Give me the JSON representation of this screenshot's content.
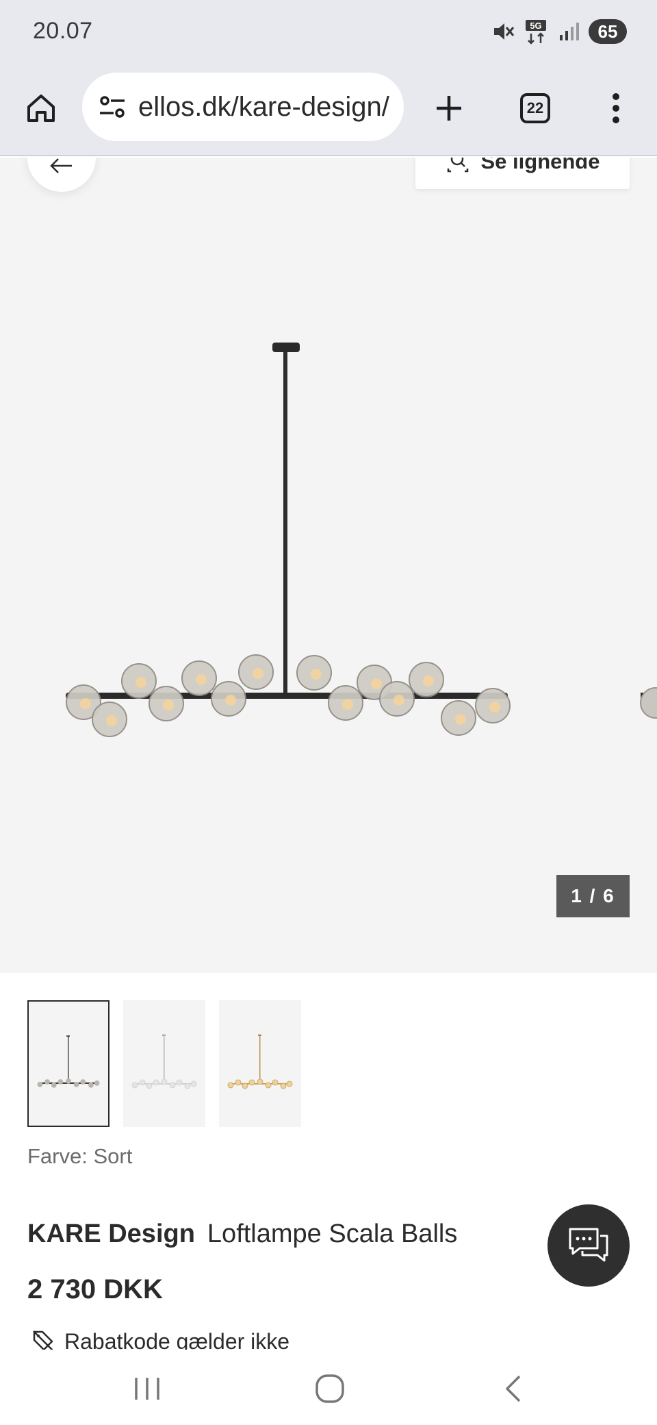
{
  "status_bar": {
    "time": "20.07",
    "network": "5G",
    "battery": "65",
    "icons": [
      "mute-icon",
      "5g-icon",
      "signal-icon",
      "battery-icon"
    ]
  },
  "browser": {
    "url": "ellos.dk/kare-design/",
    "tab_count": "22",
    "icons": [
      "home-icon",
      "site-settings-icon",
      "new-tab-icon",
      "tabs-icon",
      "menu-icon"
    ]
  },
  "gallery": {
    "similar_label": "Se lignende",
    "counter": "1 / 6",
    "current_index": 1,
    "total": 6
  },
  "thumbnails": [
    {
      "variant": "black",
      "selected": true
    },
    {
      "variant": "white",
      "selected": false
    },
    {
      "variant": "gold",
      "selected": false
    }
  ],
  "product": {
    "color_label": "Farve: Sort",
    "brand": "KARE Design",
    "name": "Loftlampe Scala Balls",
    "price": "2 730 DKK",
    "discount_note": "Rabatkode gælder ikke"
  },
  "colors": {
    "chrome": "#e8e8ef",
    "gallery_bg": "#f4f4f4",
    "counter_bg": "#5a5a5a",
    "chat_bg": "#2f2f2f",
    "text": "#2b2b2b"
  }
}
